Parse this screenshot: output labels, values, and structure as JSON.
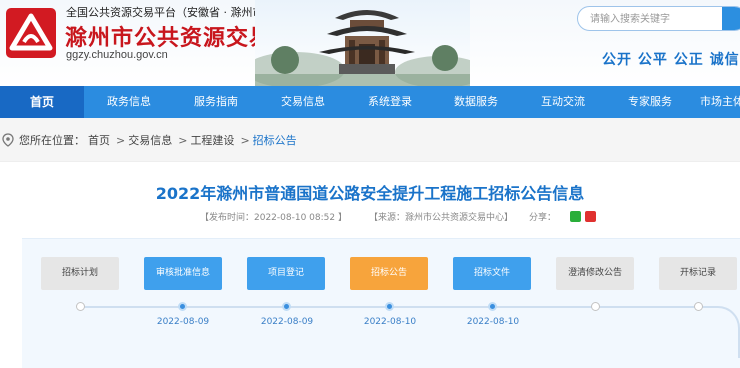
{
  "header": {
    "subtitle": "全国公共资源交易平台（安徽省 · 滁州市）",
    "title": "滁州市公共资源交易中心",
    "url": "ggzy.chuzhou.gov.cn",
    "search_placeholder": "请输入搜索关键字",
    "slogan": "公开  公平  公正  诚信"
  },
  "nav": {
    "items": [
      "首页",
      "政务信息",
      "服务指南",
      "交易信息",
      "系统登录",
      "数据服务",
      "互动交流",
      "专家服务",
      "市场主体"
    ]
  },
  "breadcrumb": {
    "prefix": "您所在位置：",
    "items": [
      "首页",
      "交易信息",
      "工程建设",
      "招标公告"
    ]
  },
  "article": {
    "title": "2022年滁州市普通国道公路安全提升工程施工招标公告信息",
    "publish_time": "【发布时间：2022-08-10 08:52 】",
    "source": "【来源：滁州市公共资源交易中心】",
    "share_label": "分享："
  },
  "process": {
    "steps": [
      "招标计划",
      "审核批准信息",
      "项目登记",
      "招标公告",
      "招标文件",
      "澄清修改公告",
      "开标记录"
    ],
    "dates": [
      "2022-08-09",
      "2022-08-09",
      "2022-08-10",
      "2022-08-10"
    ]
  },
  "colors": {
    "brand_red": "#c8161d",
    "nav_blue": "#2b8ce0",
    "title_blue": "#1a73c9",
    "active_orange": "#f7a43c"
  }
}
